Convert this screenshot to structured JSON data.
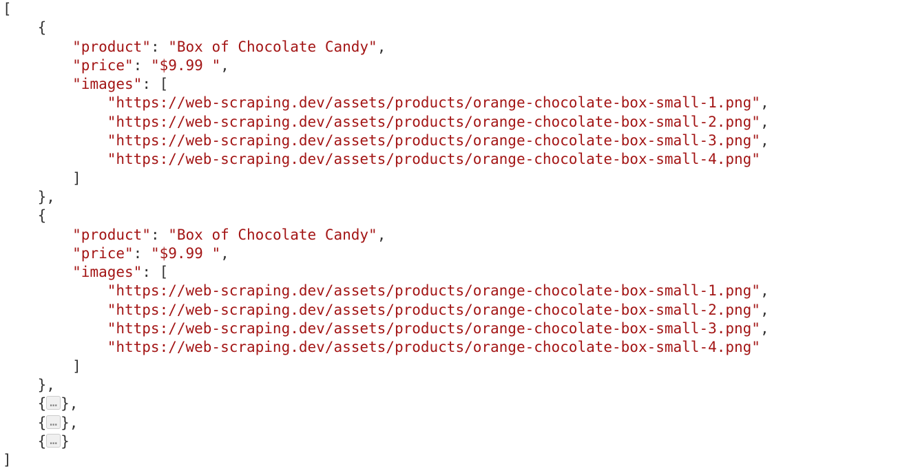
{
  "ellipsis": "…",
  "obj1": {
    "k_product": "\"product\"",
    "v_product": "\"Box of Chocolate Candy\"",
    "k_price": "\"price\"",
    "v_price": "\"$9.99 \"",
    "k_images": "\"images\"",
    "img1": "\"https://web-scraping.dev/assets/products/orange-chocolate-box-small-1.png\"",
    "img2": "\"https://web-scraping.dev/assets/products/orange-chocolate-box-small-2.png\"",
    "img3": "\"https://web-scraping.dev/assets/products/orange-chocolate-box-small-3.png\"",
    "img4": "\"https://web-scraping.dev/assets/products/orange-chocolate-box-small-4.png\""
  },
  "obj2": {
    "k_product": "\"product\"",
    "v_product": "\"Box of Chocolate Candy\"",
    "k_price": "\"price\"",
    "v_price": "\"$9.99 \"",
    "k_images": "\"images\"",
    "img1": "\"https://web-scraping.dev/assets/products/orange-chocolate-box-small-1.png\"",
    "img2": "\"https://web-scraping.dev/assets/products/orange-chocolate-box-small-2.png\"",
    "img3": "\"https://web-scraping.dev/assets/products/orange-chocolate-box-small-3.png\"",
    "img4": "\"https://web-scraping.dev/assets/products/orange-chocolate-box-small-4.png\""
  }
}
